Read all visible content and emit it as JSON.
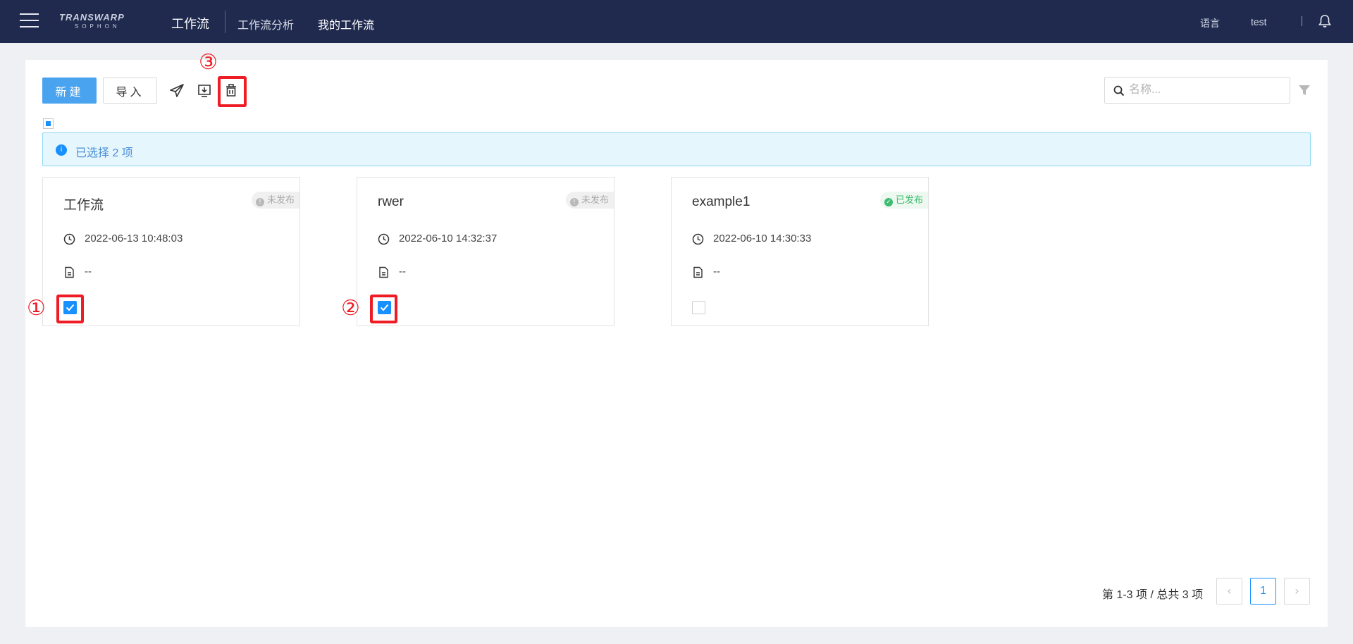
{
  "header": {
    "logo_main": "TRANSWARP",
    "logo_sub": "SOPHON",
    "title": "工作流",
    "nav": [
      "工作流分析",
      "我的工作流"
    ],
    "language": "语言",
    "user": "test"
  },
  "toolbar": {
    "new_label": "新建",
    "import_label": "导入",
    "search_placeholder": "名称...",
    "callout_delete": "③"
  },
  "selection": {
    "alert_text": "已选择 2 项"
  },
  "cards": [
    {
      "title": "工作流",
      "status": "未发布",
      "status_type": "unpublished",
      "time": "2022-06-13 10:48:03",
      "desc": "--",
      "checked": true,
      "callout": "①"
    },
    {
      "title": "rwer",
      "status": "未发布",
      "status_type": "unpublished",
      "time": "2022-06-10 14:32:37",
      "desc": "--",
      "checked": true,
      "callout": "②"
    },
    {
      "title": "example1",
      "status": "已发布",
      "status_type": "published",
      "time": "2022-06-10 14:30:33",
      "desc": "--",
      "checked": false
    }
  ],
  "pagination": {
    "info": "第 1-3 项 / 总共 3 项",
    "current_page": "1",
    "prev": "‹",
    "next": "›"
  },
  "colors": {
    "topbar": "#1f2a4e",
    "primary": "#4aa3ef",
    "highlight_box": "#ee1c25",
    "published": "#3dbb6f"
  }
}
